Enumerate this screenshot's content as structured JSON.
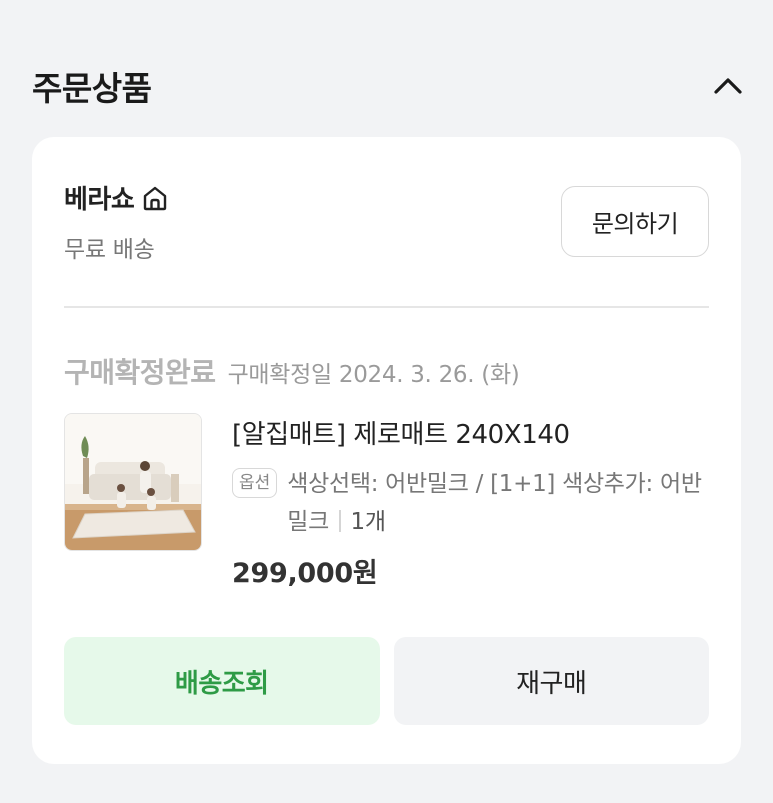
{
  "section": {
    "title": "주문상품",
    "toggle_icon": "chevron-up-icon"
  },
  "seller": {
    "name": "베라쇼",
    "icon": "home-icon",
    "shipping": "무료 배송",
    "inquiry_label": "문의하기"
  },
  "order": {
    "status": "구매확정완료",
    "date_text": "구매확정일 2024. 3. 26. (화)"
  },
  "product": {
    "name": "[알집매트] 제로매트 240X140",
    "option_badge": "옵션",
    "option_text": "색상선택: 어반밀크 / [1+1] 색상추가: 어반밀크",
    "quantity": "1개",
    "price": "299,000원"
  },
  "actions": {
    "track_label": "배송조회",
    "rebuy_label": "재구매"
  },
  "colors": {
    "track_bg": "#e6f9ea",
    "track_text": "#2e9b46"
  }
}
